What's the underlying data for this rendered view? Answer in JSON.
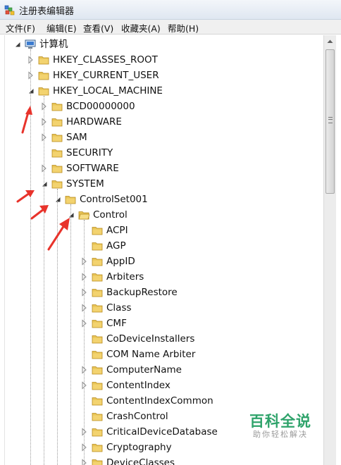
{
  "window": {
    "title": "注册表编辑器"
  },
  "menu": [
    "文件(F)",
    "编辑(E)",
    "查看(V)",
    "收藏夹(A)",
    "帮助(H)"
  ],
  "tree": [
    {
      "label": "计算机",
      "depth": 0,
      "state": "expanded",
      "icon": "computer-icon"
    },
    {
      "label": "HKEY_CLASSES_ROOT",
      "depth": 1,
      "state": "collapsed",
      "icon": "folder-icon"
    },
    {
      "label": "HKEY_CURRENT_USER",
      "depth": 1,
      "state": "collapsed",
      "icon": "folder-icon"
    },
    {
      "label": "HKEY_LOCAL_MACHINE",
      "depth": 1,
      "state": "expanded",
      "icon": "folder-icon"
    },
    {
      "label": "BCD00000000",
      "depth": 2,
      "state": "collapsed",
      "icon": "folder-icon"
    },
    {
      "label": "HARDWARE",
      "depth": 2,
      "state": "collapsed",
      "icon": "folder-icon"
    },
    {
      "label": "SAM",
      "depth": 2,
      "state": "collapsed",
      "icon": "folder-icon"
    },
    {
      "label": "SECURITY",
      "depth": 2,
      "state": "leaf",
      "icon": "folder-icon"
    },
    {
      "label": "SOFTWARE",
      "depth": 2,
      "state": "collapsed",
      "icon": "folder-icon"
    },
    {
      "label": "SYSTEM",
      "depth": 2,
      "state": "expanded",
      "icon": "folder-icon"
    },
    {
      "label": "ControlSet001",
      "depth": 3,
      "state": "expanded",
      "icon": "folder-icon"
    },
    {
      "label": "Control",
      "depth": 4,
      "state": "expanded",
      "icon": "folder-open-icon"
    },
    {
      "label": "ACPI",
      "depth": 5,
      "state": "leaf",
      "icon": "folder-icon"
    },
    {
      "label": "AGP",
      "depth": 5,
      "state": "leaf",
      "icon": "folder-icon"
    },
    {
      "label": "AppID",
      "depth": 5,
      "state": "collapsed",
      "icon": "folder-icon"
    },
    {
      "label": "Arbiters",
      "depth": 5,
      "state": "collapsed",
      "icon": "folder-icon"
    },
    {
      "label": "BackupRestore",
      "depth": 5,
      "state": "collapsed",
      "icon": "folder-icon"
    },
    {
      "label": "Class",
      "depth": 5,
      "state": "collapsed",
      "icon": "folder-icon"
    },
    {
      "label": "CMF",
      "depth": 5,
      "state": "collapsed",
      "icon": "folder-icon"
    },
    {
      "label": "CoDeviceInstallers",
      "depth": 5,
      "state": "leaf",
      "icon": "folder-icon"
    },
    {
      "label": "COM Name Arbiter",
      "depth": 5,
      "state": "leaf",
      "icon": "folder-icon"
    },
    {
      "label": "ComputerName",
      "depth": 5,
      "state": "collapsed",
      "icon": "folder-icon"
    },
    {
      "label": "ContentIndex",
      "depth": 5,
      "state": "collapsed",
      "icon": "folder-icon"
    },
    {
      "label": "ContentIndexCommon",
      "depth": 5,
      "state": "leaf",
      "icon": "folder-icon"
    },
    {
      "label": "CrashControl",
      "depth": 5,
      "state": "leaf",
      "icon": "folder-icon"
    },
    {
      "label": "CriticalDeviceDatabase",
      "depth": 5,
      "state": "collapsed",
      "icon": "folder-icon"
    },
    {
      "label": "Cryptography",
      "depth": 5,
      "state": "collapsed",
      "icon": "folder-icon"
    },
    {
      "label": "DeviceClasses",
      "depth": 5,
      "state": "collapsed",
      "icon": "folder-icon"
    }
  ],
  "annotations": {
    "arrow_color": "#e8332b",
    "arrow_count": 4
  },
  "watermark": {
    "main": "百科全说",
    "sub": "助你轻松解决",
    "color": "#2fa36b"
  },
  "colors": {
    "folder": "#e8c455",
    "expander_open": "#3aa0e0",
    "accent": "#e8332b"
  }
}
